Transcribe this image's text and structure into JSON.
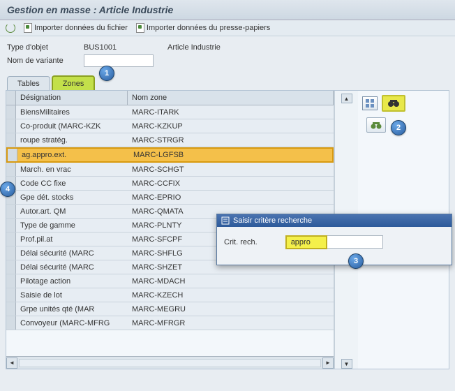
{
  "title": "Gestion en masse : Article Industrie",
  "toolbar": {
    "import_file": "Importer données du fichier",
    "import_clip": "Importer données du presse-papiers"
  },
  "form": {
    "type_label": "Type d'objet",
    "type_value": "BUS1001",
    "type_desc": "Article Industrie",
    "variant_label": "Nom de variante"
  },
  "tabs": {
    "tables": "Tables",
    "zones": "Zones"
  },
  "table": {
    "headers": {
      "designation": "Désignation",
      "zone": "Nom zone"
    },
    "rows": [
      {
        "d": "BiensMilitaires",
        "z": "MARC-ITARK"
      },
      {
        "d": "Co-produit (MARC-KZK",
        "z": "MARC-KZKUP"
      },
      {
        "d": "roupe stratég.",
        "z": "MARC-STRGR"
      },
      {
        "d": "ag.appro.ext.",
        "z": "MARC-LGFSB",
        "hl": true
      },
      {
        "d": "March. en vrac",
        "z": "MARC-SCHGT"
      },
      {
        "d": "Code CC fixe",
        "z": "MARC-CCFIX"
      },
      {
        "d": "Gpe dét. stocks",
        "z": "MARC-EPRIO"
      },
      {
        "d": "Autor.art. QM",
        "z": "MARC-QMATA"
      },
      {
        "d": "Type de gamme",
        "z": "MARC-PLNTY"
      },
      {
        "d": "Prof.pil.at",
        "z": "MARC-SFCPF"
      },
      {
        "d": "Délai sécurité (MARC",
        "z": "MARC-SHFLG"
      },
      {
        "d": "Délai sécurité (MARC",
        "z": "MARC-SHZET"
      },
      {
        "d": "Pilotage action",
        "z": "MARC-MDACH"
      },
      {
        "d": "Saisie de lot",
        "z": "MARC-KZECH"
      },
      {
        "d": "Grpe unités qté (MAR",
        "z": "MARC-MEGRU"
      },
      {
        "d": "Convoyeur (MARC-MFRG",
        "z": "MARC-MFRGR"
      }
    ]
  },
  "dialog": {
    "title": "Saisir critère recherche",
    "crit_label": "Crit. rech.",
    "crit_value": "appro"
  },
  "callouts": {
    "c1": "1",
    "c2": "2",
    "c3": "3",
    "c4": "4"
  }
}
